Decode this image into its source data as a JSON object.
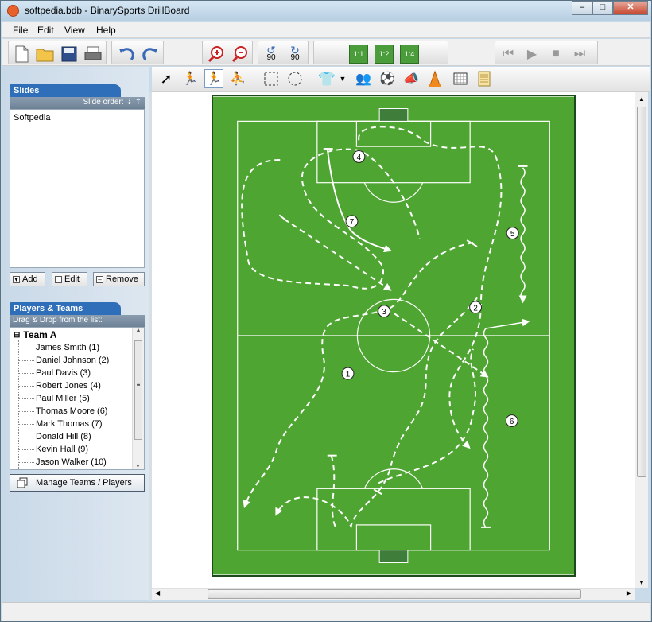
{
  "window": {
    "title": "softpedia.bdb - BinarySports DrillBoard",
    "minimize": "–",
    "maximize": "□",
    "close": "✕"
  },
  "menu": [
    "File",
    "Edit",
    "View",
    "Help"
  ],
  "toolbar": {
    "rotate_left": "90",
    "rotate_right": "90",
    "layouts": [
      "1:1",
      "1:2",
      "1:4"
    ]
  },
  "slides": {
    "header": "Slides",
    "order_label": "Slide order:",
    "items": [
      "Softpedia"
    ],
    "add": "Add",
    "edit": "Edit",
    "remove": "Remove"
  },
  "players": {
    "header": "Players & Teams",
    "hint": "Drag & Drop from the list:",
    "team": "Team A",
    "list": [
      "James Smith (1)",
      "Daniel Johnson (2)",
      "Paul Davis (3)",
      "Robert Jones (4)",
      "Paul Miller (5)",
      "Thomas Moore (6)",
      "Mark Thomas (7)",
      "Donald Hill (8)",
      "Kevin Hall (9)",
      "Jason Walker (10)"
    ],
    "manage": "Manage Teams / Players"
  },
  "pitch": {
    "players": [
      "1",
      "2",
      "3",
      "4",
      "5",
      "6",
      "7"
    ]
  },
  "colors": {
    "pitch": "#4fa532",
    "accent": "#2f6eb8"
  }
}
